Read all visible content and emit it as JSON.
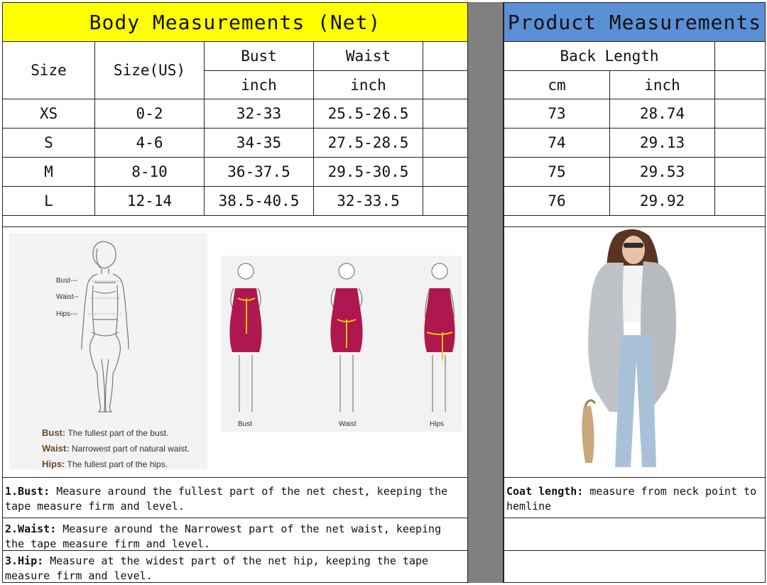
{
  "body_table": {
    "title": "Body Measurements (Net)",
    "headers": {
      "size": "Size",
      "size_us": "Size(US)",
      "bust": "Bust",
      "waist": "Waist",
      "bust_unit": "inch",
      "waist_unit": "inch"
    },
    "rows": [
      {
        "size": "XS",
        "size_us": "0-2",
        "bust": "32-33",
        "waist": "25.5-26.5"
      },
      {
        "size": "S",
        "size_us": "4-6",
        "bust": "34-35",
        "waist": "27.5-28.5"
      },
      {
        "size": "M",
        "size_us": "8-10",
        "bust": "36-37.5",
        "waist": "29.5-30.5"
      },
      {
        "size": "L",
        "size_us": "12-14",
        "bust": "38.5-40.5",
        "waist": "32-33.5"
      }
    ]
  },
  "product_table": {
    "title": "Product Measurements",
    "headers": {
      "back_length": "Back Length",
      "cm": "cm",
      "inch": "inch"
    },
    "rows": [
      {
        "cm": "73",
        "inch": "28.74"
      },
      {
        "cm": "74",
        "inch": "29.13"
      },
      {
        "cm": "75",
        "inch": "29.53"
      },
      {
        "cm": "76",
        "inch": "29.92"
      }
    ]
  },
  "figure_diagram": {
    "labels": {
      "bust": "Bust---",
      "waist": "Waist--",
      "hips": "Hips---"
    },
    "definitions": [
      {
        "term": "Bust:",
        "text": "The fullest part of the bust."
      },
      {
        "term": "Waist:",
        "text": "Narrowest part of natural waist."
      },
      {
        "term": "Hips:",
        "text": "The fullest part of the hips."
      }
    ]
  },
  "dress_diagram": {
    "captions": [
      "Bust",
      "Waist",
      "Hips"
    ],
    "dress_color": "#b0164f",
    "tape_color": "#f5c400"
  },
  "notes": {
    "bust": {
      "term": "1.Bust:",
      "text": " Measure around the fullest part of the net chest, keeping the tape  measure firm and level."
    },
    "waist": {
      "term": "2.Waist:",
      "text": " Measure around the Narrowest part of the net waist, keeping the tape  measure firm and level."
    },
    "hip": {
      "term": "3.Hip:",
      "text": " Measure at the widest part of the net hip, keeping the tape measure firm and level."
    },
    "coat": {
      "term": "Coat length:",
      "text": " measure from neck point to hemline"
    }
  },
  "colors": {
    "header_yellow": "#ffff00",
    "header_blue": "#5b8fd6",
    "gutter": "#808080"
  }
}
